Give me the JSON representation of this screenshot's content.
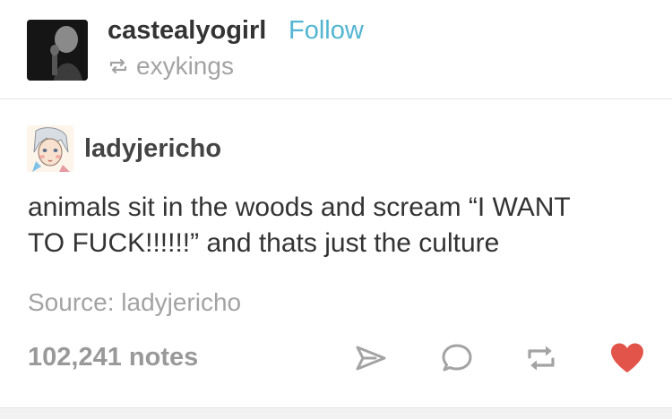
{
  "header": {
    "poster_name": "castealyogirl",
    "follow_label": "Follow",
    "reblogged_from": "exykings"
  },
  "original": {
    "author": "ladyjericho",
    "text_line1": "animals sit in the woods and scream “I WANT",
    "text_line2": "TO FUCK!!!!!!” and thats just the culture"
  },
  "source": {
    "text": "Source: ladyjericho"
  },
  "footer": {
    "notes": "102,241 notes",
    "like_color": "#e2534a"
  },
  "colors": {
    "follow": "#52b5d2",
    "muted": "#a3a3a3",
    "text": "#333333"
  },
  "icons": [
    "reblog-small-icon",
    "share-icon",
    "reply-icon",
    "reblog-icon",
    "heart-icon"
  ]
}
